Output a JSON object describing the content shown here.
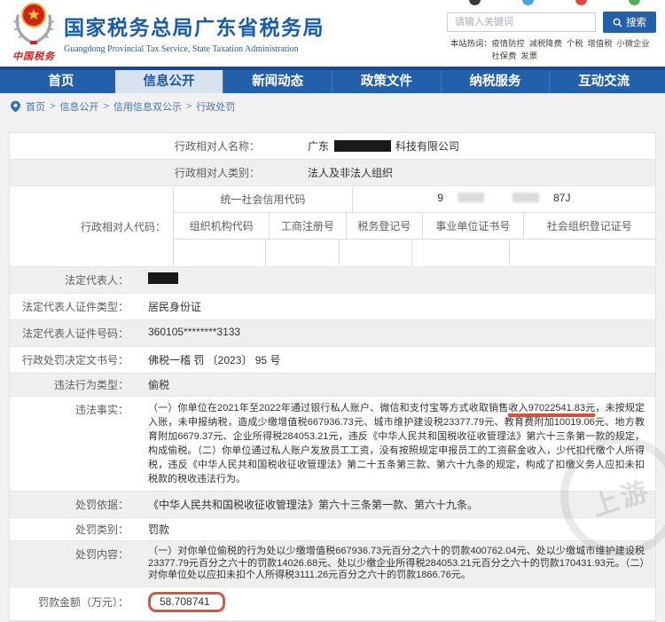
{
  "page": {
    "watermark_text": "上游"
  },
  "header": {
    "logo_text": "中国税务",
    "title": "国家税务总局广东省税务局",
    "subtitle": "Guangdong Provincial Tax Service, State Taxation Administration",
    "search": {
      "placeholder": "请输入关键词",
      "button": "搜索"
    },
    "hotwords": {
      "label": "本站热词：",
      "words": [
        "疫情防控",
        "减税降费",
        "个税",
        "增值税",
        "小微企业",
        "社保费",
        "发票"
      ]
    }
  },
  "nav": {
    "items": [
      {
        "label": "首页"
      },
      {
        "label": "信息公开",
        "active": true
      },
      {
        "label": "新闻动态"
      },
      {
        "label": "政策文件"
      },
      {
        "label": "纳税服务"
      },
      {
        "label": "互动交流"
      }
    ]
  },
  "breadcrumb": {
    "separator": ">",
    "items": [
      "首页",
      "信息公开",
      "信用信息双公示",
      "行政处罚"
    ]
  },
  "detail": {
    "name": {
      "label": "行政相对人名称：",
      "prefix": "广东",
      "suffix": "科技有限公司"
    },
    "category": {
      "label": "行政相对人类别：",
      "value": "法人及非法人组织"
    },
    "codes": {
      "label": "行政相对人代码：",
      "credit_code_label": "统一社会信用代码",
      "credit_code_prefix": "9",
      "credit_code_suffix": "87J",
      "columns": [
        "组织机构代码",
        "工商注册号",
        "税务登记号",
        "事业单位证书号",
        "社会组织登记证号"
      ]
    },
    "legal_rep": {
      "label": "法定代表人："
    },
    "id_type": {
      "label": "法定代表人证件类型：",
      "value": "居民身份证"
    },
    "id_number": {
      "label": "法定代表人证件号码：",
      "value": "360105********3133"
    },
    "doc_no": {
      "label": "行政处罚决定文书号：",
      "value": "佛税一稽 罚 〔2023〕 95 号"
    },
    "violation_type": {
      "label": "违法行为类型：",
      "value": "偷税"
    },
    "facts": {
      "label": "违法事实：",
      "part1": "（一）你单位在2021年至2022年通过银行私人账户、微信和支付宝等方式收取销售",
      "highlight": "收入97022541.83元",
      "part2": "，未按规定入账，未申报纳税，造成少缴增值税667936.73元、城市维护建设税23377.79元、教育费附加10019.06元、地方教育附加6679.37元、企业所得税284053.21元，违反《中华人民共和国税收征收管理法》第六十三条第一款的规定，构成偷税。（二）你单位通过私人账户发放员工工资，没有按照规定申报员工的工资薪金收入，少代扣代缴个人所得税，违反《中华人民共和国税收征收管理法》第二十五条第三款、第六十九条的规定，构成了扣缴义务人应扣未扣税款的税收违法行为。"
    },
    "basis": {
      "label": "处罚依据：",
      "value": "《中华人民共和国税收征收管理法》第六十三条第一款、第六十九条。"
    },
    "penalty_type": {
      "label": "处罚类别：",
      "value": "罚款"
    },
    "penalty_content": {
      "label": "处罚内容：",
      "value": "（一）对你单位偷税的行为处以少缴增值税667936.73元百分之六十的罚款400762.04元、处以少缴城市维护建设税23377.79元百分之六十的罚款14026.68元、处以少缴企业所得税284053.21元百分之六十的罚款170431.93元。（二）对你单位处以应扣未扣个人所得税3111.26元百分之六十的罚款1866.76元。"
    },
    "fine_amount": {
      "label": "罚款金额（万元）：",
      "value": "58.708741"
    }
  }
}
